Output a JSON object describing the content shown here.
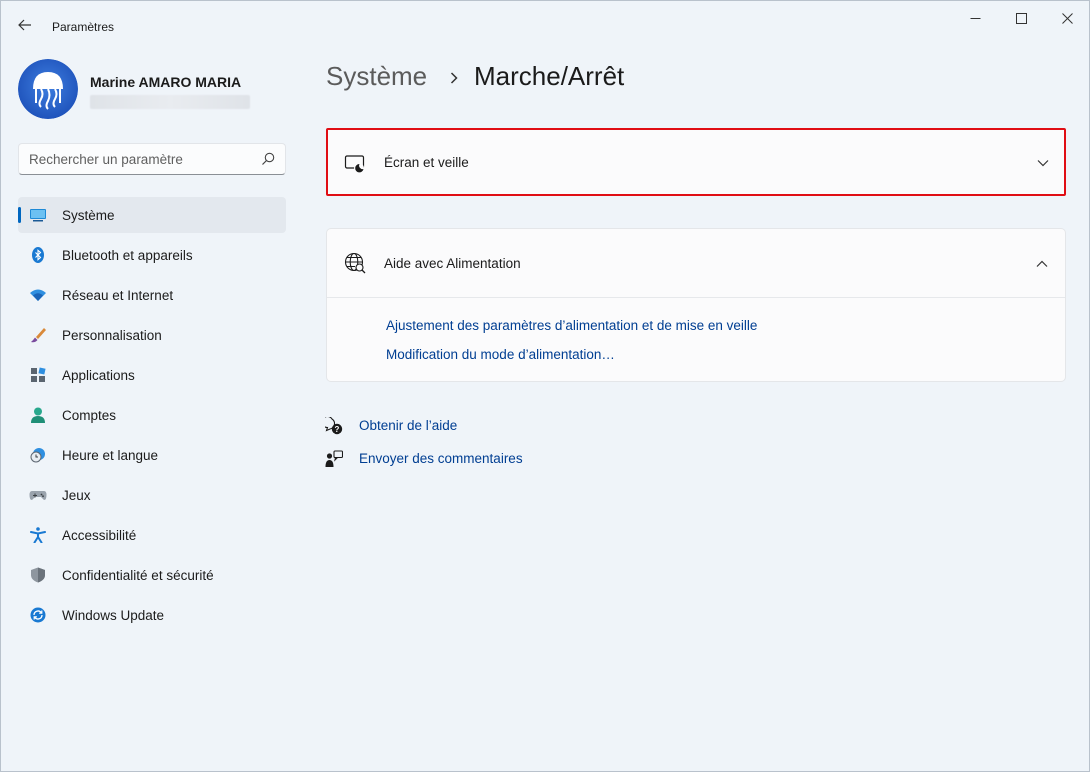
{
  "window": {
    "title": "Paramètres",
    "back_icon": "arrow-left-icon",
    "controls": [
      "minimize-icon",
      "maximize-icon",
      "close-icon"
    ]
  },
  "profile": {
    "name": "Marine AMARO MARIA",
    "avatar_icon": "jellyfish-avatar",
    "email_state": "blurred"
  },
  "search": {
    "placeholder": "Rechercher un paramètre",
    "value": ""
  },
  "sidebar": {
    "items": [
      {
        "label": "Système",
        "icon": "monitor-icon",
        "active": true
      },
      {
        "label": "Bluetooth et appareils",
        "icon": "bluetooth-icon"
      },
      {
        "label": "Réseau et Internet",
        "icon": "wifi-icon"
      },
      {
        "label": "Personnalisation",
        "icon": "paintbrush-icon"
      },
      {
        "label": "Applications",
        "icon": "apps-icon"
      },
      {
        "label": "Comptes",
        "icon": "person-icon"
      },
      {
        "label": "Heure et langue",
        "icon": "clock-globe-icon"
      },
      {
        "label": "Jeux",
        "icon": "gamepad-icon"
      },
      {
        "label": "Accessibilité",
        "icon": "accessibility-icon"
      },
      {
        "label": "Confidentialité et sécurité",
        "icon": "shield-icon"
      },
      {
        "label": "Windows Update",
        "icon": "sync-icon"
      }
    ]
  },
  "breadcrumb": {
    "parent": "Système",
    "current": "Marche/Arrêt"
  },
  "cards": {
    "screen_sleep": {
      "title": "Écran et veille",
      "icon": "screen-sleep-icon",
      "expanded": false,
      "highlight_color": "#e00d14"
    },
    "power_help": {
      "title": "Aide avec Alimentation",
      "icon": "globe-search-icon",
      "expanded": true,
      "links": [
        "Ajustement des paramètres d’alimentation et de mise en veille",
        "Modification du mode d’alimentation…"
      ]
    }
  },
  "footer": {
    "get_help": "Obtenir de l’aide",
    "feedback": "Envoyer des commentaires"
  },
  "colors": {
    "accent": "#0067c0",
    "link": "#003e92",
    "background": "#eff4f9"
  }
}
